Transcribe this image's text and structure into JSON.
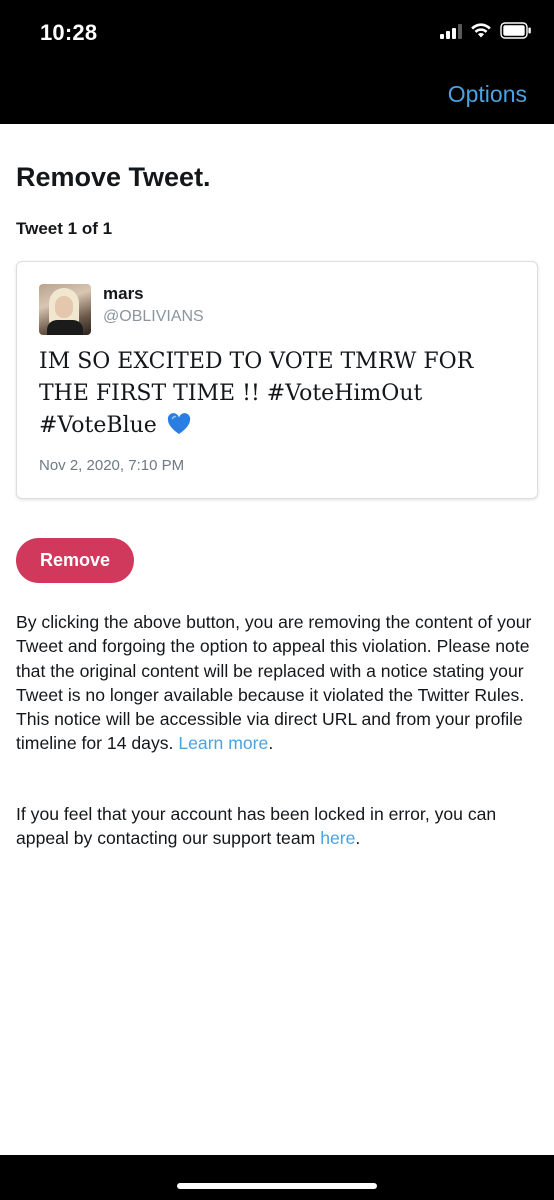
{
  "status_bar": {
    "time": "10:28"
  },
  "nav": {
    "options_label": "Options"
  },
  "page": {
    "title": "Remove Tweet.",
    "tweet_count": "Tweet 1 of 1"
  },
  "tweet": {
    "author_name": "mars",
    "author_handle": "@OBLIVIANS",
    "text": "IM SO EXCITED TO VOTE TMRW FOR THE FIRST TIME !! #VoteHimOut #VoteBlue",
    "emoji": "blue-heart-icon",
    "date": "Nov 2, 2020, 7:10 PM"
  },
  "remove_button_label": "Remove",
  "body_text": {
    "paragraph_1": "By clicking the above button, you are removing the content of your Tweet and forgoing the option to appeal this violation. Please note that the original content will be replaced with a notice stating your Tweet is no longer available because it violated the Twitter Rules. This notice will be accessible via direct URL and from your profile timeline for 14 days.",
    "learn_more_link": "Learn more",
    "paragraph_1_end": ".",
    "paragraph_2": "If you feel that your account has been locked in error, you can appeal by contacting our support team",
    "here_link": "here",
    "paragraph_2_end": "."
  },
  "colors": {
    "accent_link": "#4aa3df",
    "remove_button": "#d0395c",
    "heart": "#2a7de1"
  }
}
